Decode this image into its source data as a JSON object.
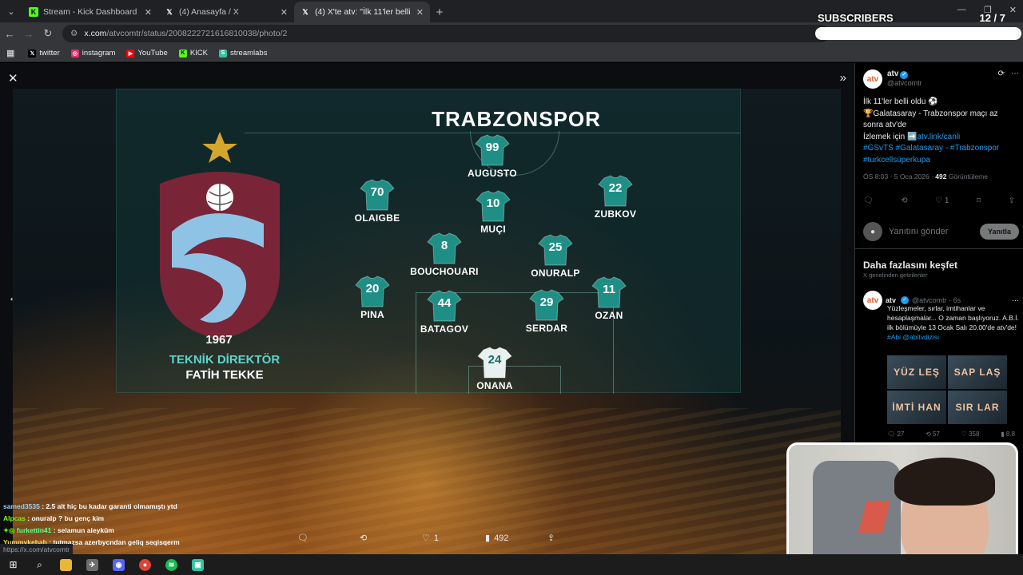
{
  "browser": {
    "tabs": [
      {
        "label": "Stream - Kick Dashboard",
        "icon": "kick-icon",
        "color": "#53fc18"
      },
      {
        "label": "(4) Anasayfa / X",
        "icon": "x-logo-icon",
        "color": "#ffffff"
      },
      {
        "label": "(4) X'te atv: \"İlk 11'ler belli oldu",
        "icon": "x-logo-icon",
        "color": "#ffffff",
        "active": true
      }
    ],
    "url_site": "x.com",
    "url_path": "/atvcomtr/status/2008222721616810038/photo/2",
    "bookmarks": [
      {
        "label": "twitter",
        "icon": "x-logo-icon",
        "color": "#000000"
      },
      {
        "label": "instagram",
        "icon": "instagram-icon",
        "color": "#e1306c"
      },
      {
        "label": "YouTube",
        "icon": "youtube-icon",
        "color": "#ff0000"
      },
      {
        "label": "KICK",
        "icon": "kick-icon",
        "color": "#53fc18"
      },
      {
        "label": "streamlabs",
        "icon": "streamlabs-icon",
        "color": "#31c3a2"
      }
    ]
  },
  "overlay": {
    "subscribers_label": "SUBSCRIBERS",
    "subscribers_count": "12 / 7",
    "progress": 1.0
  },
  "lineup": {
    "team": "TRABZONSPOR",
    "founded": "1967",
    "coach_title": "TEKNİK DİREKTÖR",
    "coach_name": "FATİH TEKKE",
    "players": [
      {
        "number": "99",
        "name": "AUGUSTO"
      },
      {
        "number": "70",
        "name": "OLAIGBE"
      },
      {
        "number": "10",
        "name": "MUÇI"
      },
      {
        "number": "22",
        "name": "ZUBKOV"
      },
      {
        "number": "8",
        "name": "BOUCHOUARI"
      },
      {
        "number": "25",
        "name": "ONURALP"
      },
      {
        "number": "20",
        "name": "PINA"
      },
      {
        "number": "44",
        "name": "BATAGOV"
      },
      {
        "number": "29",
        "name": "SERDAR"
      },
      {
        "number": "11",
        "name": "OZAN"
      },
      {
        "number": "24",
        "name": "ONANA"
      }
    ],
    "colors": {
      "jersey": "#1f8f86",
      "goalkeeper": "#e9f1f0",
      "crest_maroon": "#7a2437",
      "crest_blue": "#8fc3e6",
      "star": "#d4a72c"
    }
  },
  "viewer_actions": {
    "likes": "1",
    "views": "492"
  },
  "chat": [
    {
      "user": "samed3535",
      "message": ": 2.5 alt hiç bu kadar garanti olmamıştı ytd"
    },
    {
      "user": "Alpcas",
      "message": ": onuralp ? bu genç kim"
    },
    {
      "user": "furkettin41",
      "message": ": selamun aleyküm"
    },
    {
      "user": "Yummykebab",
      "message": ": tutmazsa azerbycndan geliq seqisqerm"
    }
  ],
  "status_url": "https://x.com/atvcomtr",
  "tweet": {
    "author": "atv",
    "avatar_text": "atv",
    "handle": "@atvcomtr",
    "line1": "İlk 11'ler belli oldu ⚽",
    "line2": "🏆Galatasaray - Trabzonspor maçı az sonra atv'de",
    "line3_prefix": "İzlemek için ➡️",
    "link": "atv.link/canli",
    "hashtags": "#GSvTS #Galatasaray - #Trabzonspor #turkcellsüperkupa",
    "time": "ÖS 8:03 · 5 Oca 2026 · ",
    "views": "492",
    "views_label": " Görüntüleme",
    "likes": "1",
    "reply_placeholder": "Yanıtını gönder",
    "reply_button": "Yanıtla"
  },
  "discover": {
    "title": "Daha fazlasını keşfet",
    "subtitle": "X genelinden getirilenler",
    "related": {
      "author": "atv",
      "handle": "@atvcomtr · 6s",
      "text": "Yüzleşmeler, sırlar, imtihanlar ve hesaplaşmalar... O zaman başlıyoruz. A.B.İ. ilk bölümüyle 13 Ocak Salı 20.00'de atv'de!",
      "hashtags": "#Abi @abitvdizisi",
      "images": [
        "YÜZ LEŞ",
        "SAP LAŞ",
        "İMTİ HAN",
        "SIR LAR"
      ],
      "replies": "27",
      "reposts": "57",
      "likes": "358",
      "views": "8.8"
    }
  }
}
